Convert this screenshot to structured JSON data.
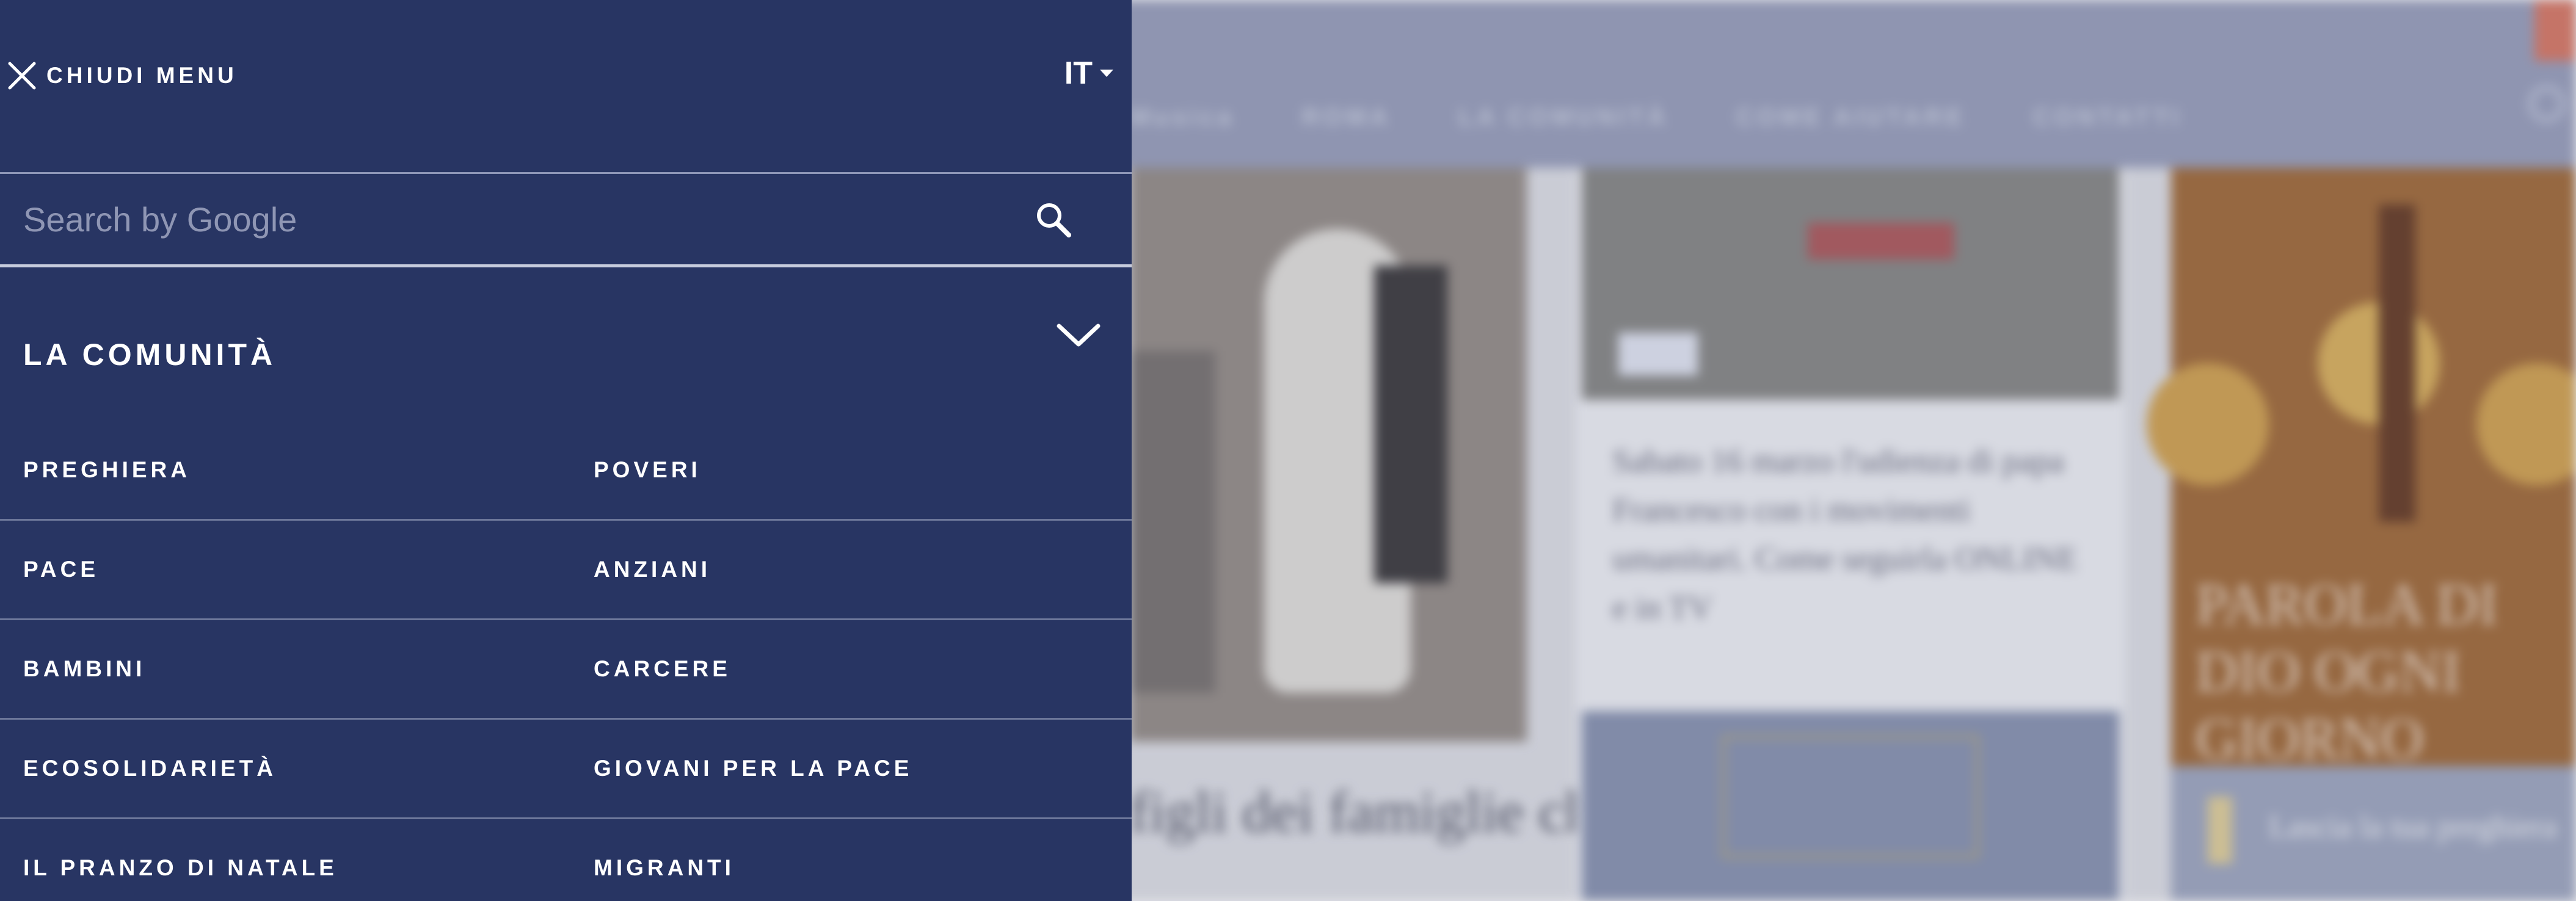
{
  "background": {
    "nav_items": [
      "Musica",
      "ROMA",
      "LA COMUNITÀ",
      "COME AIUTARE",
      "CONTATTI"
    ],
    "article_text": "Sabato 16 marzo l'udienza di papa Francesco con i movimenti umanitari. Come seguirla ONLINE e in TV",
    "article_title": "figli dei famiglie che li",
    "feature_text": "PAROLA DI DIO OGNI GIORNO",
    "prayer_text": "Lascia la tua preghiera"
  },
  "menu": {
    "close_label": "CHIUDI MENU",
    "language": "IT",
    "search": {
      "placeholder": "Search by Google"
    },
    "section": {
      "title": "LA COMUNITÀ",
      "expanded": true,
      "rows": [
        [
          "PREGHIERA",
          "POVERI"
        ],
        [
          "PACE",
          "ANZIANI"
        ],
        [
          "BAMBINI",
          "CARCERE"
        ],
        [
          "ECOSOLIDARIETÀ",
          "GIOVANI PER LA PACE"
        ],
        [
          "IL PRANZO DI NATALE",
          "MIGRANTI"
        ]
      ]
    }
  },
  "icons": {
    "close": "close-icon",
    "language_caret": "caret-down-icon",
    "search": "search-icon",
    "section_toggle": "chevron-down-icon"
  },
  "colors": {
    "menu_bg": "#283563",
    "text": "#ffffff",
    "divider": "#6d779a",
    "placeholder": "#8f96b4"
  }
}
